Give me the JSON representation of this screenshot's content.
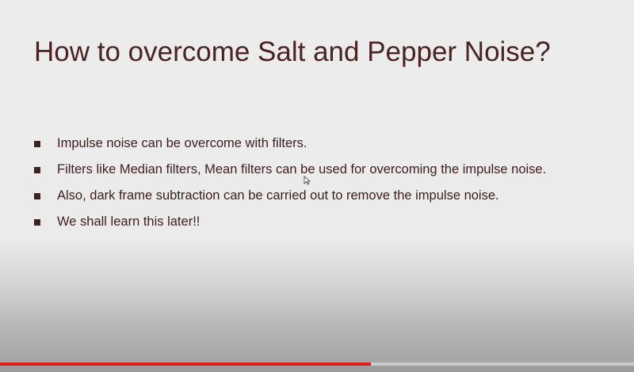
{
  "slide": {
    "title": "How to overcome Salt and Pepper Noise?",
    "bullets": [
      "Impulse noise can be overcome with filters.",
      "Filters like Median filters, Mean filters can be used for overcoming the impulse noise.",
      "Also, dark frame subtraction can be carried out to remove the impulse noise.",
      "We shall learn this later!!"
    ]
  },
  "video": {
    "progress_fraction": 0.585,
    "progress_color": "#e01c1c"
  },
  "colors": {
    "title": "#4a2323",
    "text": "#3e2020"
  }
}
